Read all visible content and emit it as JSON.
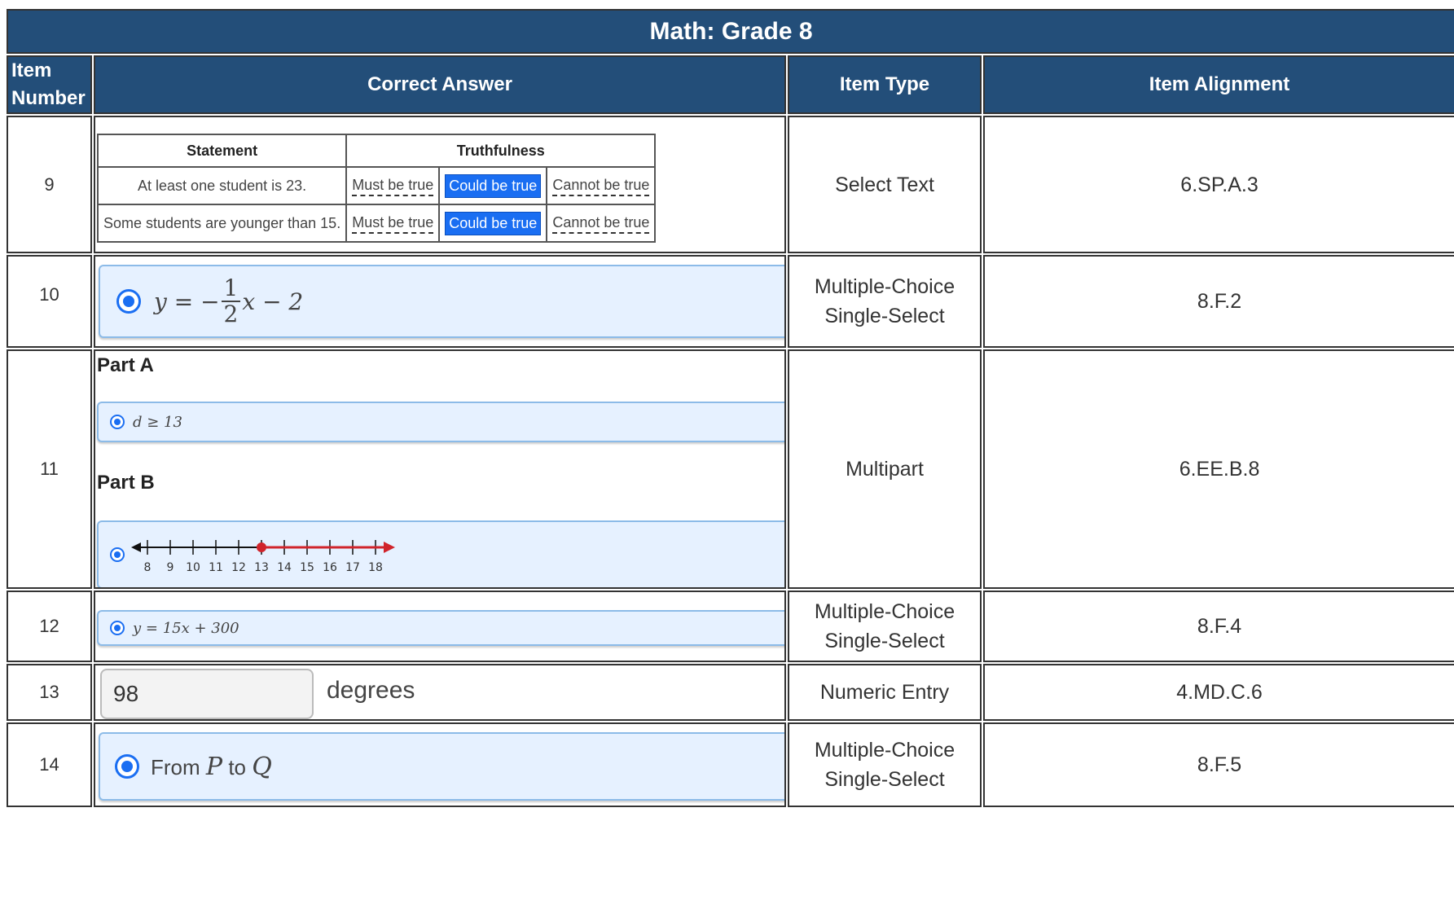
{
  "title": "Math: Grade 8",
  "headers": {
    "item_number_line1": "Item",
    "item_number_line2": "Number",
    "correct_answer": "Correct Answer",
    "item_type": "Item Type",
    "item_alignment": "Item Alignment"
  },
  "rows": [
    {
      "number": "9",
      "type": "Select Text",
      "alignment": "6.SP.A.3",
      "table": {
        "col_statement": "Statement",
        "col_truthfulness": "Truthfulness",
        "statements": [
          "At least one student is 23.",
          "Some students are younger than 15."
        ],
        "options": [
          "Must be true",
          "Could be true",
          "Cannot be true"
        ],
        "selected": "Could be true"
      }
    },
    {
      "number": "10",
      "type_line1": "Multiple-Choice",
      "type_line2": "Single-Select",
      "alignment": "8.F.2",
      "answer": {
        "lhs": "y = −",
        "num": "1",
        "den": "2",
        "rhs": "x − 2"
      }
    },
    {
      "number": "11",
      "type": "Multipart",
      "alignment": "6.EE.B.8",
      "part_a_label": "Part A",
      "part_a_answer": "d ≥ 13",
      "part_b_label": "Part B",
      "number_line": {
        "ticks": [
          "8",
          "9",
          "10",
          "11",
          "12",
          "13",
          "14",
          "15",
          "16",
          "17",
          "18"
        ],
        "closed_point": 13,
        "direction": "right"
      }
    },
    {
      "number": "12",
      "type_line1": "Multiple-Choice",
      "type_line2": "Single-Select",
      "alignment": "8.F.4",
      "answer": "y = 15x + 300"
    },
    {
      "number": "13",
      "type": "Numeric Entry",
      "alignment": "4.MD.C.6",
      "value": "98",
      "units": "degrees"
    },
    {
      "number": "14",
      "type_line1": "Multiple-Choice",
      "type_line2": "Single-Select",
      "alignment": "8.F.5",
      "answer_from": "From",
      "answer_p": "P",
      "answer_to": "to",
      "answer_q": "Q"
    }
  ],
  "colors": {
    "header_bg": "#234e79",
    "selected_bg": "#1a6ef2",
    "choice_bg": "#e6f1ff",
    "number_line_red": "#d0242b"
  }
}
